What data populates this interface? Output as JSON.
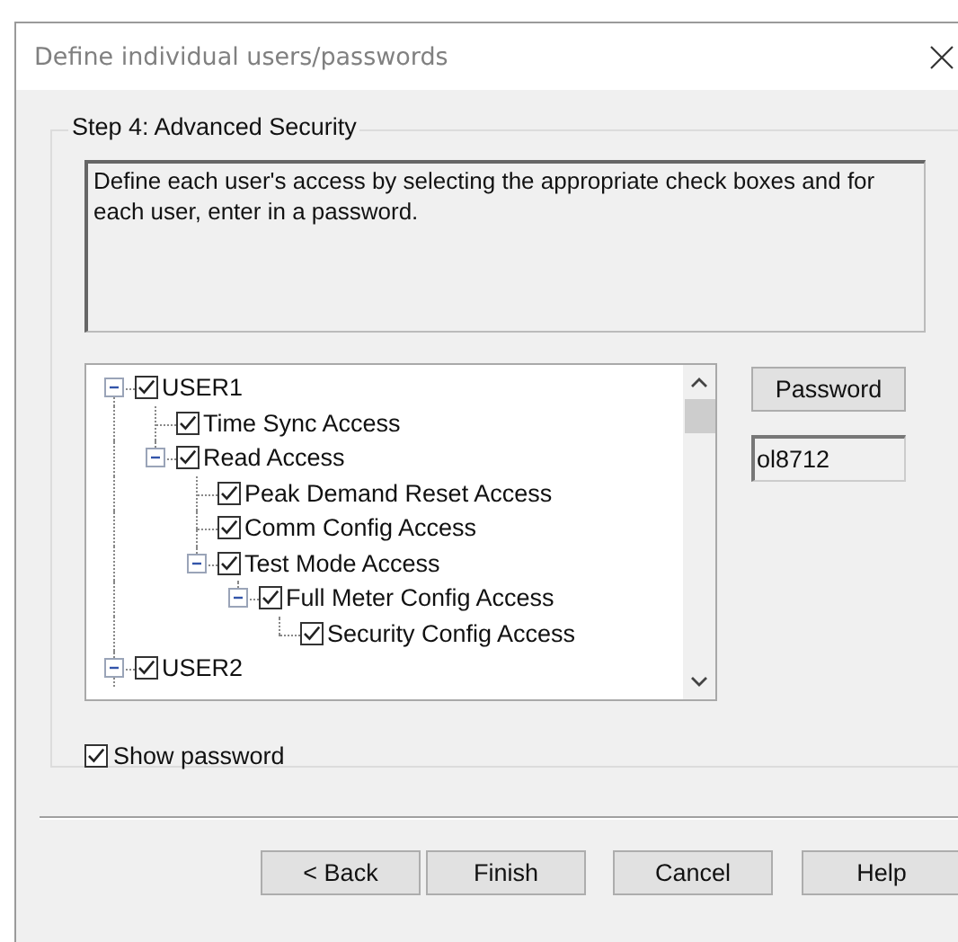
{
  "window": {
    "title": "Define individual users/passwords"
  },
  "group": {
    "title": "Step 4: Advanced Security"
  },
  "description": "Define each user's access by selecting the appropriate check boxes and for each user, enter in a password.",
  "tree": [
    {
      "label": "USER1",
      "checked": true,
      "expanded": true,
      "selected": false,
      "children": [
        {
          "label": "Time Sync Access",
          "checked": true,
          "selected": false
        },
        {
          "label": "Read Access",
          "checked": true,
          "expanded": true,
          "selected": false,
          "children": [
            {
              "label": "Peak Demand Reset Access",
              "checked": true,
              "selected": false
            },
            {
              "label": "Comm Config Access",
              "checked": true,
              "selected": false
            },
            {
              "label": "Test Mode Access",
              "checked": true,
              "expanded": true,
              "selected": false,
              "children": [
                {
                  "label": "Full Meter Config Access",
                  "checked": true,
                  "expanded": true,
                  "selected": false,
                  "children": [
                    {
                      "label": "Security Config Access",
                      "checked": true,
                      "selected": false
                    }
                  ]
                }
              ]
            }
          ]
        }
      ]
    },
    {
      "label": "USER2",
      "checked": true,
      "expanded": true,
      "selected": false
    }
  ],
  "password_button": "Password",
  "password_value": "ol8712",
  "show_password": {
    "label": "Show password",
    "checked": true
  },
  "buttons": [
    "< Back",
    "Finish",
    "Cancel",
    "Help"
  ]
}
